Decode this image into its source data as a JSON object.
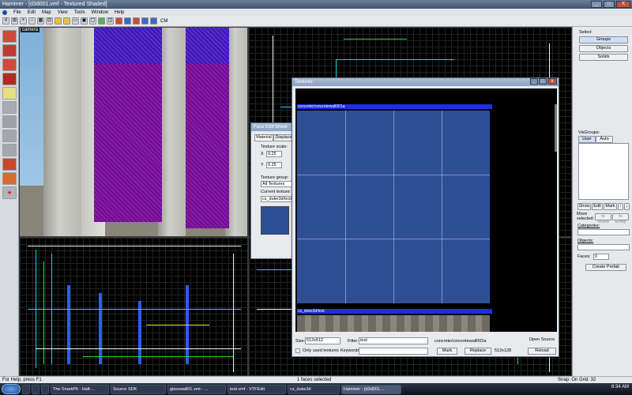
{
  "window": {
    "title": "Hammer - [d3d001.vmf - Textured Shaded]",
    "buttons": [
      "_",
      "□",
      "X"
    ]
  },
  "menu": [
    "File",
    "Edit",
    "Map",
    "View",
    "Tools",
    "Window",
    "Help"
  ],
  "toolbar": {
    "cm_label": "CM"
  },
  "viewports": {
    "camera_label": "camera"
  },
  "right_panel": {
    "select_label": "Select:",
    "groups": "Groups",
    "objects": "Objects",
    "solids": "Solids",
    "visgroups_label": "VisGroups:",
    "tab_user": "User",
    "tab_auto": "Auto",
    "show": "Show",
    "edit": "Edit",
    "mark": "Mark",
    "move_selected": "Move selected:",
    "to_world": "to World",
    "to_entity": "to Entity",
    "categories": "Categories:",
    "objects_label": "Objects:",
    "faces_label": "Faces:",
    "faces_value": "0",
    "create_prefab": "Create Prefab"
  },
  "face_edit": {
    "title": "Face Edit Sheet",
    "tab_material": "Material",
    "tab_displace": "Displace",
    "texture_scale": "Texture scale:",
    "x_label": "X",
    "x_value": "0.25",
    "y_label": "Y",
    "y_value": "0.25",
    "texture_group_label": "Texture group:",
    "texture_group_value": "All Textures",
    "current_texture_label": "Current texture:",
    "current_texture_value": "cs_duke3d/test"
  },
  "textures": {
    "title": "Textures",
    "top_name": "concrete/concretewall001a",
    "bottom_name": "cs_duke3d/test",
    "size_label": "Size:",
    "size_value": "512x512",
    "filter_label": "Filter:",
    "filter_value": "test",
    "selected_texture": "concrete/concretewall002a",
    "open_source": "Open Source",
    "only_used": "Only used textures",
    "keywords_label": "Keywords:",
    "mark": "Mark",
    "replace": "Replace",
    "dimensions": "512x128",
    "reload": "Reload"
  },
  "status": {
    "left": "For Help, press F1",
    "center": "1 faces selected",
    "right": "Snap: On Grid: 32"
  },
  "taskbar": {
    "items": [
      "The SnarkPit - Half-...",
      "Source SDK",
      "glasswall01.vmt - ...",
      "test.vmf - VTFEdit",
      "cs_duke3d",
      "Hammer - [d3d001...."
    ],
    "clock": "8:34 AM"
  }
}
